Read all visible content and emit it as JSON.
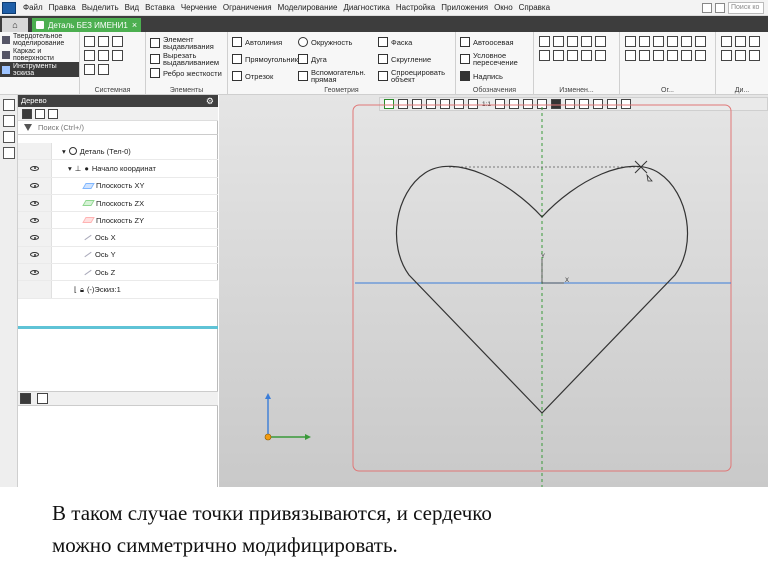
{
  "menubar": {
    "items": [
      "Файл",
      "Правка",
      "Выделить",
      "Вид",
      "Вставка",
      "Черчение",
      "Ограничения",
      "Моделирование",
      "Диагностика",
      "Настройка",
      "Приложения",
      "Окно",
      "Справка"
    ],
    "search_placeholder": "Поиск ко"
  },
  "tabs": {
    "home_icon": "home-icon",
    "document_tab": "Деталь БЕЗ ИМЕНИ1",
    "close_glyph": "×"
  },
  "ribbon": {
    "modes": [
      {
        "label": "Твердотельное моделирование",
        "active": false
      },
      {
        "label": "Каркас и поверхности",
        "active": false
      },
      {
        "label": "Инструменты эскиза",
        "active": true
      }
    ],
    "groups": {
      "system": "Системная",
      "elements": "Элементы",
      "geometry": "Геометрия",
      "notation": "Обозначения",
      "edit": "Изменен...",
      "constraints": "Ог...",
      "dimensions": "Ди..."
    },
    "element_tools": [
      "Элемент выдавливания",
      "Вырезать выдавливанием",
      "Ребро жесткости"
    ],
    "geometry_tools": [
      "Автолиния",
      "Окружность",
      "Фаска",
      "Прямоугольник",
      "Дуга",
      "Скругление",
      "Отрезок",
      "Вспомогательн. прямая",
      "Спроецировать объект"
    ],
    "notation_tools": [
      "Автоосевая",
      "Условное пересечение",
      "Надпись"
    ]
  },
  "tree": {
    "header": "Дерево",
    "search_placeholder": "Поиск (Ctrl+/)",
    "rows": [
      {
        "label": "Деталь (Тел-0)",
        "eye": false,
        "indent": 1
      },
      {
        "label": "Начало координат",
        "eye": true,
        "indent": 2
      },
      {
        "label": "Плоскость XY",
        "eye": true,
        "indent": 3,
        "color": "#7fb6ff"
      },
      {
        "label": "Плоскость ZX",
        "eye": true,
        "indent": 3,
        "color": "#8fd68f"
      },
      {
        "label": "Плоскость ZY",
        "eye": true,
        "indent": 3,
        "color": "#ffb3b3"
      },
      {
        "label": "Ось X",
        "eye": true,
        "indent": 3
      },
      {
        "label": "Ось Y",
        "eye": true,
        "indent": 3
      },
      {
        "label": "Ось Z",
        "eye": true,
        "indent": 3
      },
      {
        "label": "(-)Эскиз:1",
        "eye": false,
        "indent": 2
      }
    ]
  },
  "viewport": {
    "axis_x_label": "X",
    "axis_y_label": "Y",
    "toolbar_labels": [
      "1:1"
    ]
  },
  "caption": {
    "line1": "В таком случае точки привязываются, и сердечко",
    "line2": "можно симметрично модифицировать."
  },
  "colors": {
    "accent_tab": "#4caf50",
    "sketch_line": "#333333",
    "axis_green": "#3a9a3a",
    "axis_blue": "#3b7dd8",
    "frame_red": "#e07777",
    "tree_divider": "#5fc3d6"
  }
}
